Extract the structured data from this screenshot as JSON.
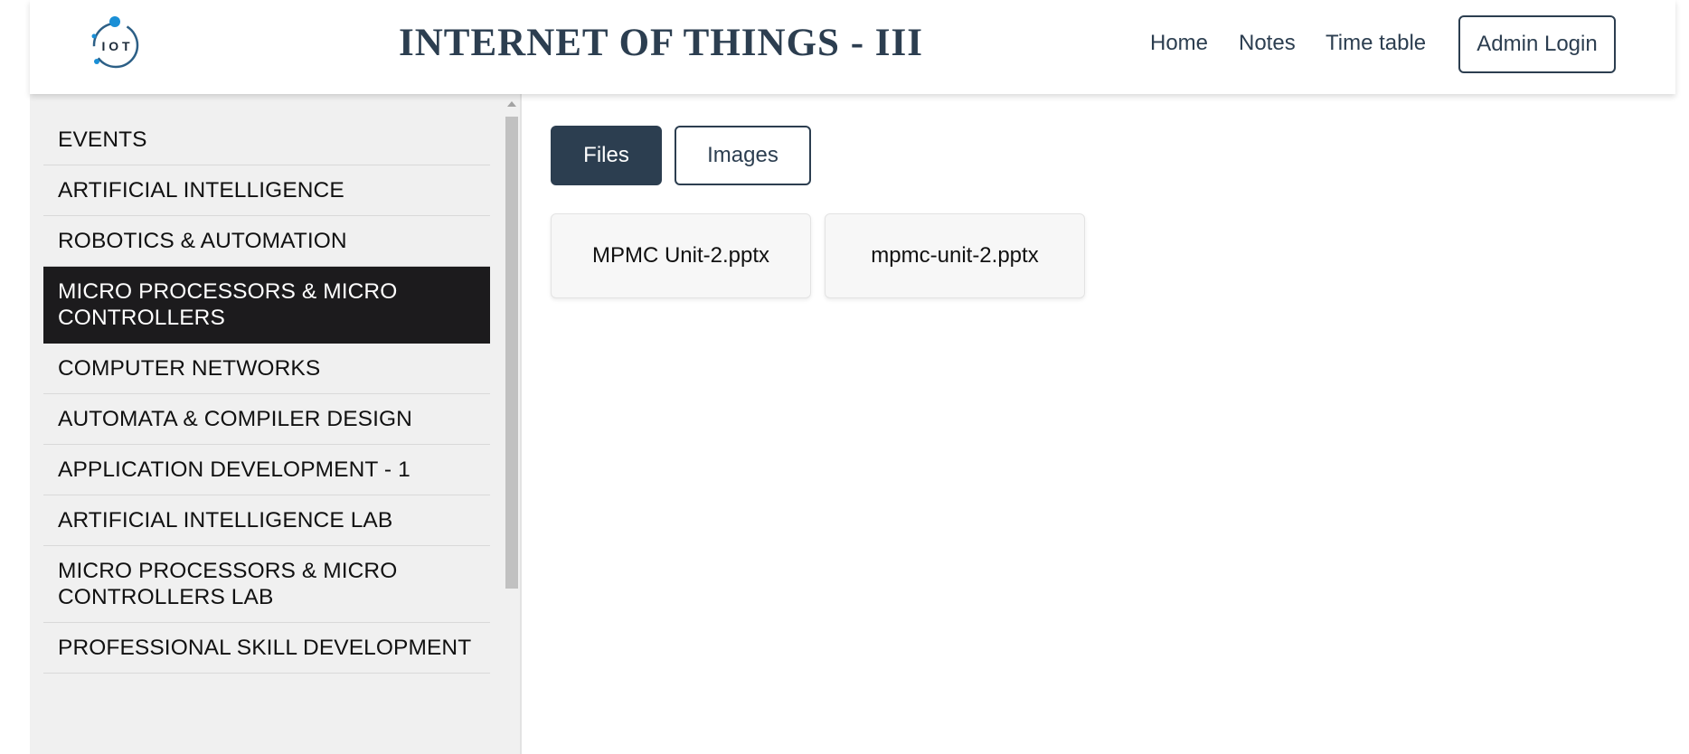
{
  "header": {
    "logo_text": "I O T",
    "title": "INTERNET OF THINGS - III",
    "nav": {
      "home": "Home",
      "notes": "Notes",
      "timetable": "Time table"
    },
    "admin_login": "Admin Login"
  },
  "sidebar": {
    "items": [
      {
        "label": "EVENTS",
        "active": false
      },
      {
        "label": "ARTIFICIAL INTELLIGENCE",
        "active": false
      },
      {
        "label": "ROBOTICS & AUTOMATION",
        "active": false
      },
      {
        "label": "MICRO PROCESSORS & MICRO CONTROLLERS",
        "active": true
      },
      {
        "label": "COMPUTER NETWORKS",
        "active": false
      },
      {
        "label": "AUTOMATA & COMPILER DESIGN",
        "active": false
      },
      {
        "label": "APPLICATION DEVELOPMENT - 1",
        "active": false
      },
      {
        "label": "ARTIFICIAL INTELLIGENCE LAB",
        "active": false
      },
      {
        "label": "MICRO PROCESSORS & MICRO CONTROLLERS LAB",
        "active": false
      },
      {
        "label": "PROFESSIONAL SKILL DEVELOPMENT",
        "active": false
      }
    ]
  },
  "main": {
    "tabs": {
      "files": "Files",
      "images": "Images",
      "selected": "Files"
    },
    "files": [
      {
        "name": "MPMC Unit-2.pptx"
      },
      {
        "name": "mpmc-unit-2.pptx"
      }
    ]
  },
  "colors": {
    "primary": "#2c3e50",
    "active_item": "#1c1b1d",
    "sidebar_bg": "#f0f0f0",
    "logo_blue": "#1a8fd6"
  },
  "icons": {
    "logo": "iot-logo-icon",
    "scroll_up": "scroll-up-arrow-icon"
  }
}
